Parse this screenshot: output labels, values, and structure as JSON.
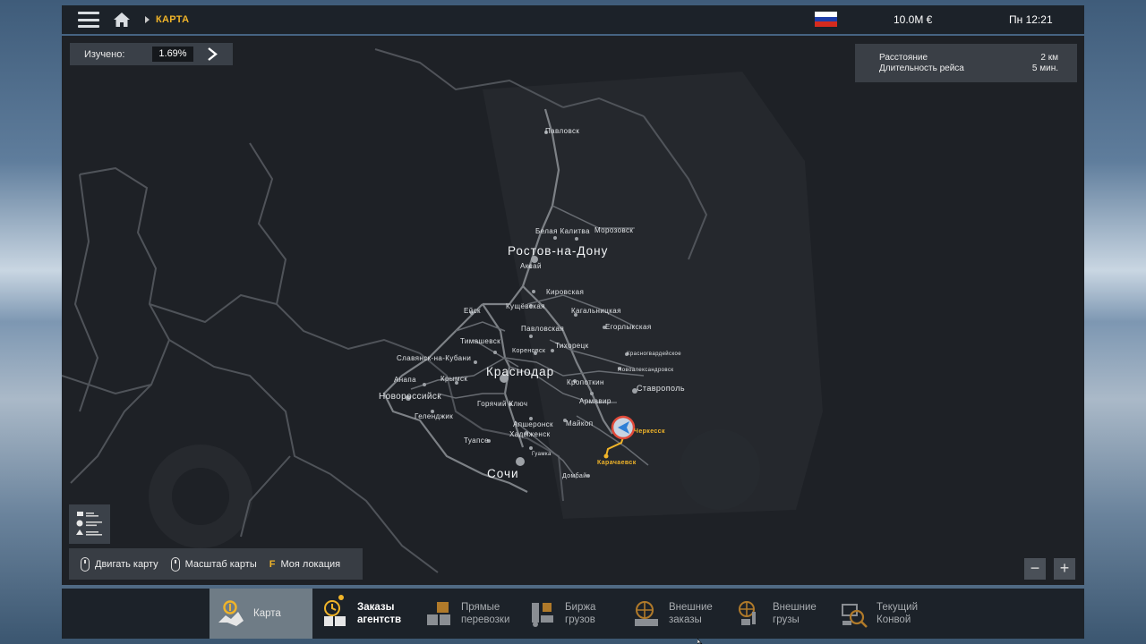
{
  "topbar": {
    "breadcrumb": "КАРТА",
    "money": "10.0M  €",
    "clock": "Пн 12:21",
    "flag_colors": [
      "#ffffff",
      "#1f3fa8",
      "#d52b1e"
    ],
    "accent": "#f0b429"
  },
  "explored": {
    "label": "Изучено:",
    "value": "1.69%"
  },
  "route": {
    "distance_label": "Расстояние",
    "distance_value": "2 км",
    "duration_label": "Длительность рейса",
    "duration_value": "5 мин."
  },
  "cities_large": [
    "Ростов-на-Дону",
    "Краснодар",
    "Сочи"
  ],
  "cities": [
    "Павловск",
    "Белая Калитва",
    "Морозовск",
    "Аксай",
    "Кировская",
    "Ейск",
    "Кущёвская",
    "Кагальницкая",
    "Павловская",
    "Егорлыкская",
    "Тимашевск",
    "Тихорецк",
    "Кореновск",
    "Красногвардейское",
    "Славянск-на-Кубани",
    "Новоалександровск",
    "Крымск",
    "Анапа",
    "Кропоткин",
    "Новороссийск",
    "Ставрополь",
    "Горячий Ключ",
    "Армавир",
    "Геленджик",
    "Апшеронск",
    "Майкоп",
    "Хадыженск",
    "Туапсе",
    "Гуамка",
    "Домбай"
  ],
  "route_cities": [
    "Черкесск",
    "Карачаевск"
  ],
  "hints": {
    "move": "Двигать карту",
    "scale": "Масштаб карты",
    "loc_key": "F",
    "loc": "Моя локация"
  },
  "zoom": {
    "out": "−",
    "in": "+"
  },
  "tabs": [
    {
      "line1": "Карта",
      "line2": ""
    },
    {
      "line1": "Заказы",
      "line2": "агентств"
    },
    {
      "line1": "Прямые",
      "line2": "перевозки"
    },
    {
      "line1": "Биржа",
      "line2": "грузов"
    },
    {
      "line1": "Внешние",
      "line2": "заказы"
    },
    {
      "line1": "Внешние",
      "line2": "грузы"
    },
    {
      "line1": "Текущий",
      "line2": "Конвой"
    }
  ]
}
